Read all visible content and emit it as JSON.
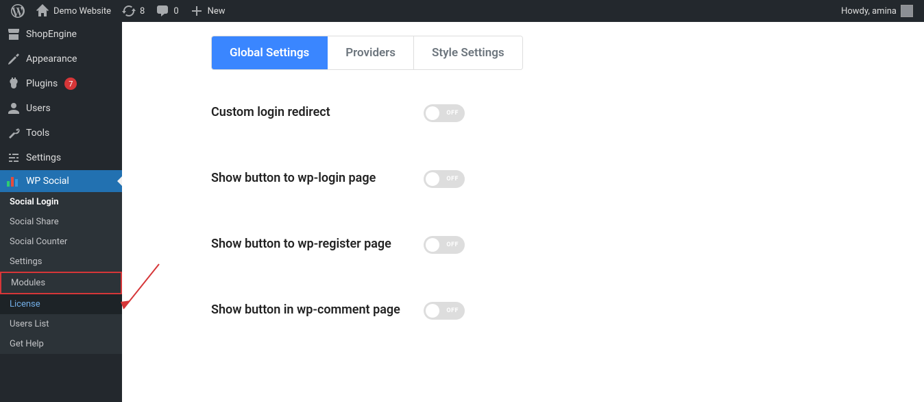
{
  "adminbar": {
    "site_name": "Demo Website",
    "updates": "8",
    "comments": "0",
    "new_label": "New",
    "howdy": "Howdy, amina"
  },
  "sidebar": {
    "items": [
      {
        "label": "ShopEngine",
        "icon": "store"
      },
      {
        "label": "Appearance",
        "icon": "brush"
      },
      {
        "label": "Plugins",
        "icon": "plug",
        "badge": "7"
      },
      {
        "label": "Users",
        "icon": "user"
      },
      {
        "label": "Tools",
        "icon": "wrench"
      },
      {
        "label": "Settings",
        "icon": "sliders"
      },
      {
        "label": "WP Social",
        "icon": "bars",
        "current": true
      }
    ],
    "submenu": [
      {
        "label": "Social Login",
        "bold": true
      },
      {
        "label": "Social Share"
      },
      {
        "label": "Social Counter"
      },
      {
        "label": "Settings"
      },
      {
        "label": "Modules",
        "highlighted": true
      },
      {
        "label": "License",
        "blue": true
      },
      {
        "label": "Users List"
      },
      {
        "label": "Get Help"
      }
    ]
  },
  "content": {
    "tabs": [
      {
        "label": "Global Settings",
        "active": true
      },
      {
        "label": "Providers"
      },
      {
        "label": "Style Settings"
      }
    ],
    "settings": [
      {
        "label": "Custom login redirect",
        "state": "OFF"
      },
      {
        "label": "Show button to wp-login page",
        "state": "OFF"
      },
      {
        "label": "Show button to wp-register page",
        "state": "OFF"
      },
      {
        "label": "Show button in wp-comment page",
        "state": "OFF"
      }
    ]
  }
}
